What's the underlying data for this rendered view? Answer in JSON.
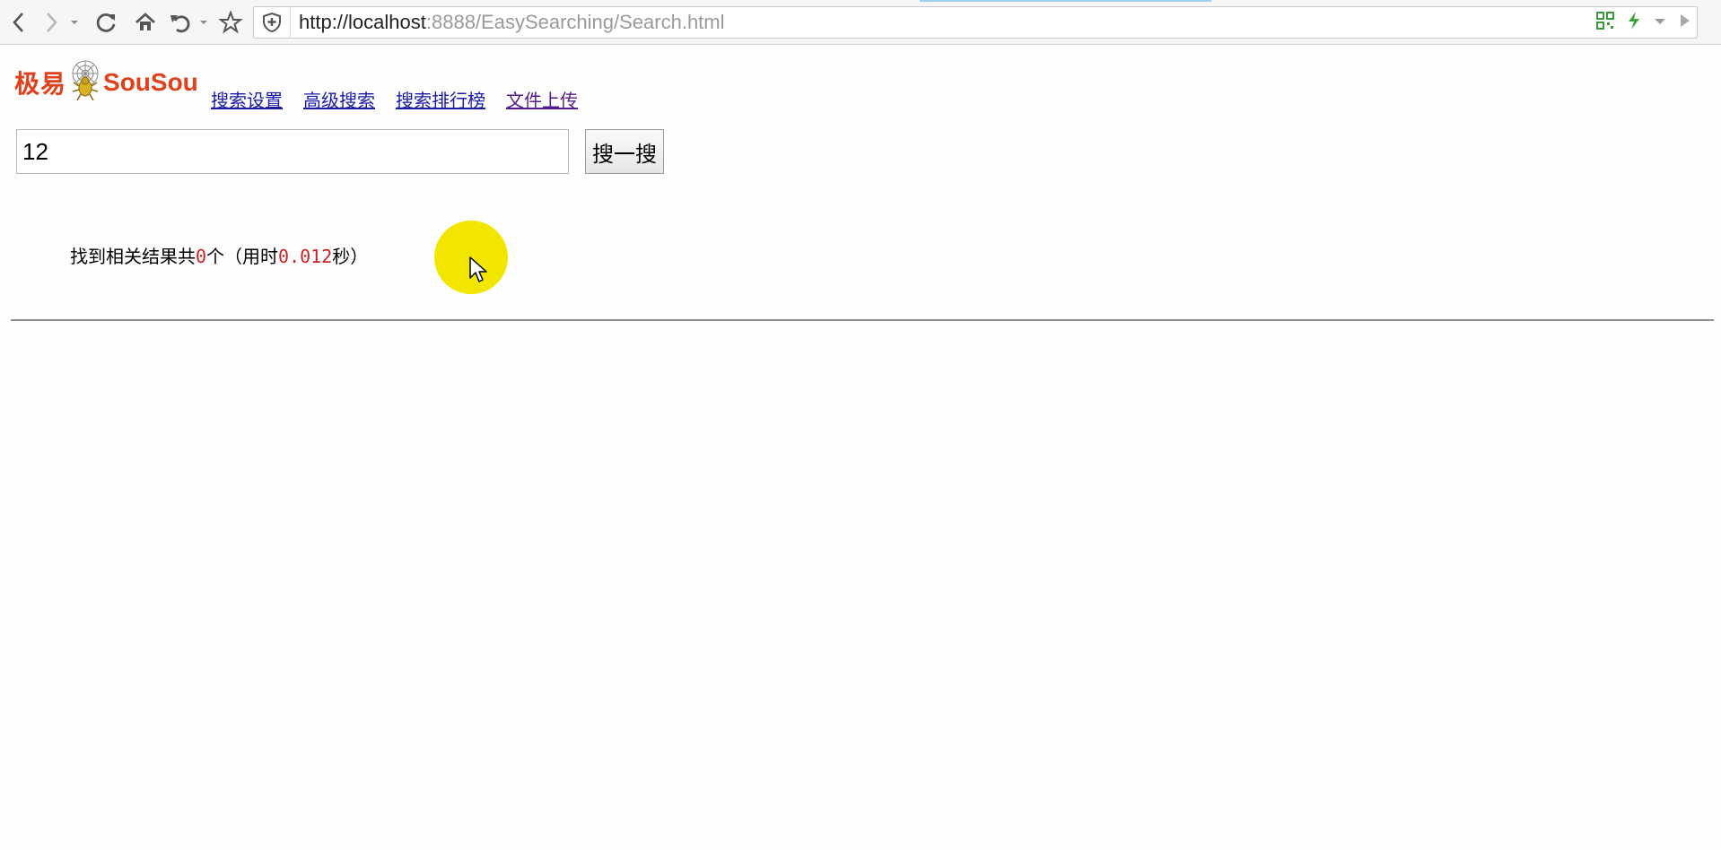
{
  "browser": {
    "url_host": "http://localhost",
    "url_rest": ":8888/EasySearching/Search.html",
    "icons": [
      "back-icon",
      "forward-icon",
      "dropdown-icon",
      "reload-icon",
      "home-icon",
      "undo-icon",
      "bookmark-star-icon",
      "shield-icon",
      "qr-code-icon",
      "lightning-icon",
      "chevron-down-icon",
      "play-icon"
    ]
  },
  "logo": {
    "cn": "极易",
    "en": "SouSou"
  },
  "nav": {
    "items": [
      {
        "label": "搜索设置"
      },
      {
        "label": "高级搜索"
      },
      {
        "label": "搜索排行榜"
      },
      {
        "label": "文件上传"
      }
    ]
  },
  "search": {
    "value": "12",
    "button_label": "搜一搜"
  },
  "result": {
    "prefix": "找到相关结果共",
    "count": "0",
    "mid": "个（用时",
    "time": "0.012",
    "suffix": "秒）"
  },
  "colors": {
    "logo": "#e0401a",
    "link": "#1a1aa6",
    "highlight_number": "#cc2222",
    "cursor_halo": "#f2e600"
  }
}
